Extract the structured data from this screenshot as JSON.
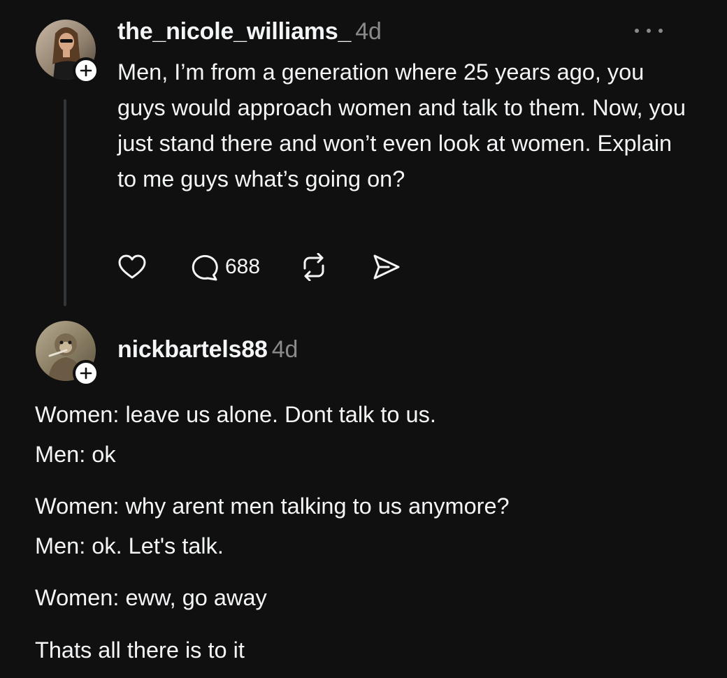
{
  "post": {
    "username": "the_nicole_williams_",
    "time": "4d",
    "text": "Men, I’m from a generation where 25 years ago, you guys would approach women and talk to them. Now, you just stand there and won’t even look at women. Explain to me guys what’s going on?",
    "reply_count": "688",
    "avatar_icon": "profile-photo",
    "more_icon": "ellipsis-icon"
  },
  "reply": {
    "username": "nickbartels88",
    "time": "4d",
    "lines": [
      "Women: leave us alone. Dont talk to us.",
      "Men: ok",
      "Women: why arent men talking to us anymore?",
      "Men: ok. Let's talk.",
      "Women: eww, go away",
      "Thats all there is to it"
    ],
    "avatar_icon": "profile-photo"
  },
  "colors": {
    "background": "#101010",
    "text": "#f3f5f7",
    "secondary": "#8a8a8a",
    "thread_line": "#333638"
  }
}
